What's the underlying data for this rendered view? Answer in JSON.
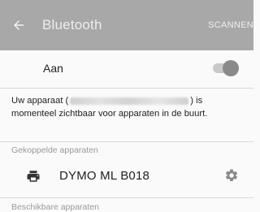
{
  "appbar": {
    "title": "Bluetooth",
    "scan_label": "SCANNEN",
    "back_icon": "arrow-left-icon"
  },
  "toggle": {
    "label": "Aan",
    "state": "on"
  },
  "description": {
    "prefix": "Uw apparaat (",
    "suffix": ") is momenteel zichtbaar voor apparaten in de buurt."
  },
  "sections": {
    "paired_title": "Gekoppelde apparaten",
    "available_title": "Beschikbare apparaten"
  },
  "paired_devices": [
    {
      "name": "DYMO ML B018",
      "icon": "printer-icon",
      "settings_icon": "gear-icon"
    }
  ]
}
